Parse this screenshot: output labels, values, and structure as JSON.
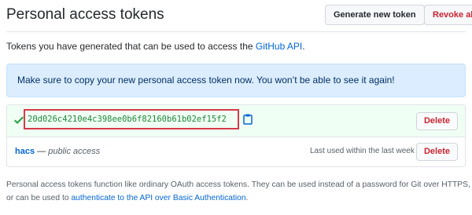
{
  "header": {
    "title": "Personal access tokens",
    "generate_label": "Generate new token",
    "revoke_label": "Revoke all"
  },
  "intro": {
    "text": "Tokens you have generated that can be used to access the",
    "link": "GitHub API",
    "suffix": "."
  },
  "notice": {
    "text": "Make sure to copy your new personal access token now. You won’t be able to see it again!"
  },
  "tokens": [
    {
      "value": "20d026c4210e4c398ee0b6f82160b61b02ef15f2",
      "delete_label": "Delete"
    },
    {
      "name": "hacs",
      "separator": " — ",
      "scope": "public access",
      "last_used": "Last used within the last week",
      "delete_label": "Delete"
    }
  ],
  "footer": {
    "line1": "Personal access tokens function like ordinary OAuth access tokens. They can be used instead of a password for Git over HTTPS,",
    "line2_prefix": "or can be used to",
    "line2_link": "authenticate to the API over Basic Authentication",
    "line2_suffix": "."
  },
  "colors": {
    "link": "#0366d6",
    "danger": "#cb2431",
    "success": "#22863a",
    "notice_bg": "#dbedff",
    "highlight_box": "#d73a49"
  },
  "icons": {
    "check": "check-icon",
    "clipboard": "clipboard-icon"
  }
}
